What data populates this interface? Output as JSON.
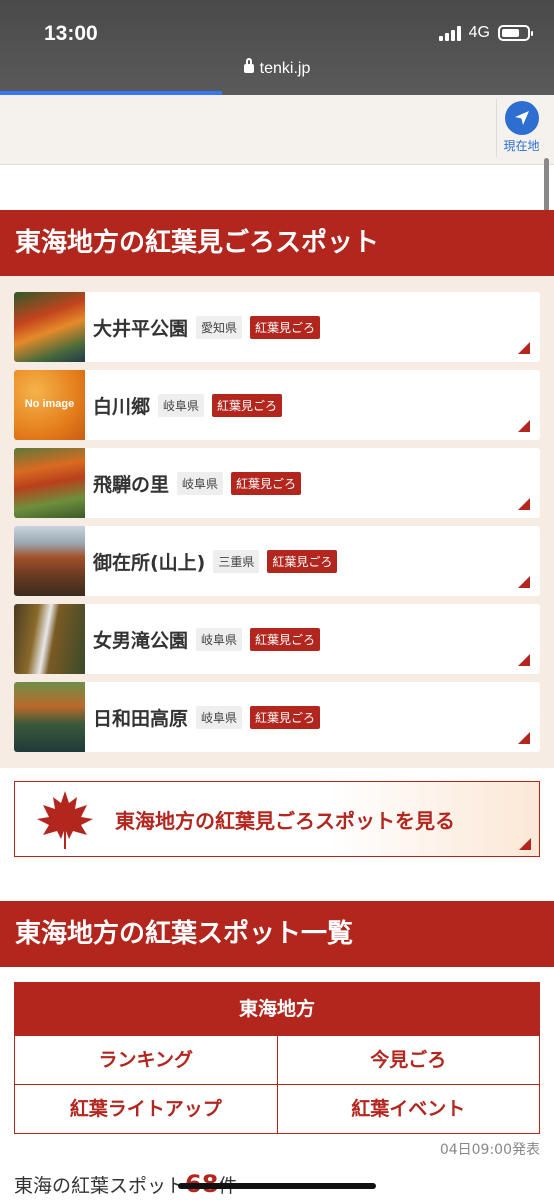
{
  "status": {
    "time": "13:00",
    "network": "4G",
    "url": "tenki.jp",
    "page_load_progress": 0.4
  },
  "header": {
    "location_label": "現在地"
  },
  "spots_section": {
    "title": "東海地方の紅葉見ごろスポット",
    "spots": [
      {
        "name": "大井平公園",
        "pref": "愛知県",
        "tag": "紅葉見ごろ"
      },
      {
        "name": "白川郷",
        "pref": "岐阜県",
        "tag": "紅葉見ごろ",
        "no_image": "No image"
      },
      {
        "name": "飛騨の里",
        "pref": "岐阜県",
        "tag": "紅葉見ごろ"
      },
      {
        "name": "御在所(山上)",
        "pref": "三重県",
        "tag": "紅葉見ごろ"
      },
      {
        "name": "女男滝公園",
        "pref": "岐阜県",
        "tag": "紅葉見ごろ"
      },
      {
        "name": "日和田高原",
        "pref": "岐阜県",
        "tag": "紅葉見ごろ"
      }
    ],
    "more_link": "東海地方の紅葉見ごろスポットを見る"
  },
  "list_section": {
    "title": "東海地方の紅葉スポット一覧",
    "table_head": "東海地方",
    "links": [
      "ランキング",
      "今見ごろ",
      "紅葉ライトアップ",
      "紅葉イベント"
    ],
    "announce": "04日09:00発表",
    "count_prefix": "東海の紅葉スポット",
    "count_value": "68",
    "count_suffix": "件"
  }
}
